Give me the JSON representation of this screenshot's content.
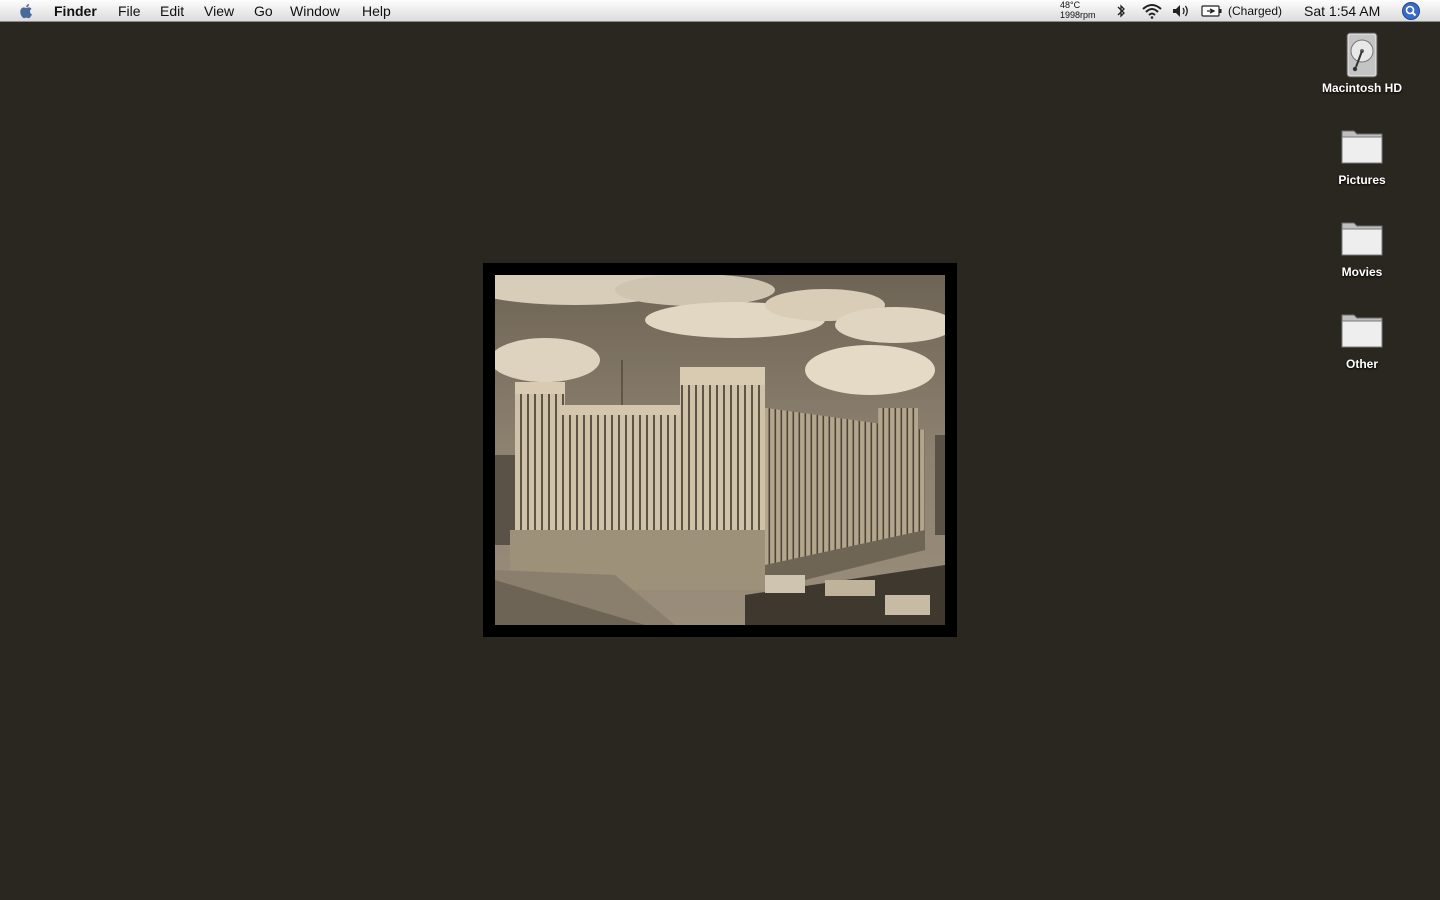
{
  "menubar": {
    "app_name": "Finder",
    "menus": [
      "File",
      "Edit",
      "View",
      "Go",
      "Window",
      "Help"
    ],
    "temperature": "48°C",
    "fan_speed": "1998rpm",
    "battery_status": "(Charged)",
    "clock": "Sat 1:54 AM",
    "status_icons": [
      "bluetooth-icon",
      "wifi-icon",
      "volume-icon",
      "battery-icon",
      "spotlight-icon"
    ]
  },
  "desktop": {
    "background_color": "#2a2620",
    "icons": [
      {
        "label": "Macintosh HD",
        "icon": "hard-drive-icon"
      },
      {
        "label": "Pictures",
        "icon": "folder-icon"
      },
      {
        "label": "Movies",
        "icon": "folder-icon"
      },
      {
        "label": "Other",
        "icon": "folder-icon"
      }
    ],
    "wallpaper_photo": "sepia-building-photo"
  }
}
